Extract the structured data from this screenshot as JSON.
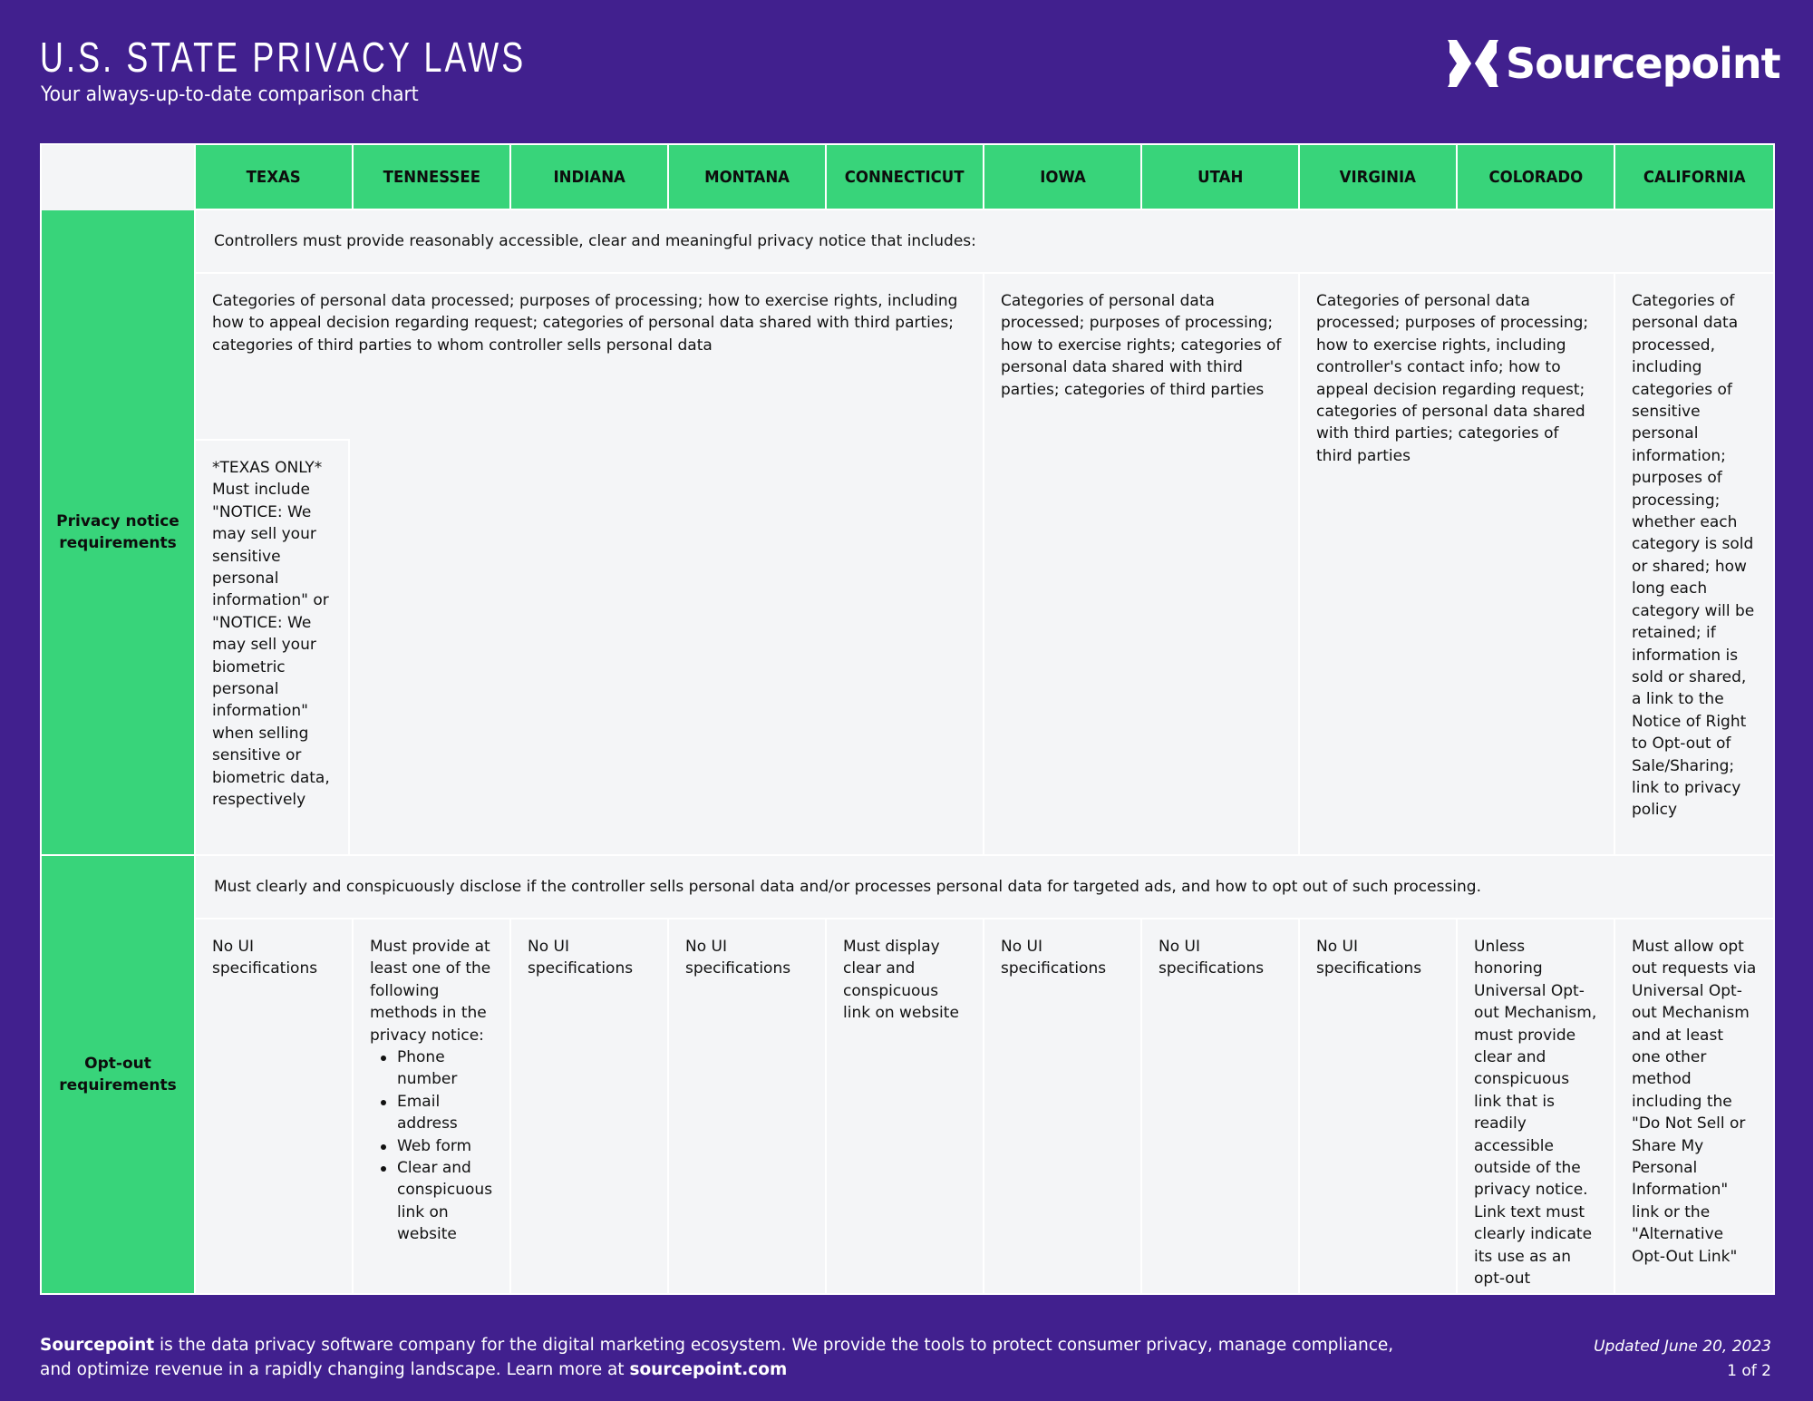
{
  "header": {
    "title": "U.S. STATE PRIVACY LAWS",
    "subtitle": "Your always-up-to-date comparison chart",
    "logo_text": "Sourcepoint",
    "logo_icon": "sourcepoint-chevrons-icon"
  },
  "colors": {
    "background": "#41208e",
    "accent_green": "#38d47a",
    "cell_background": "#f4f5f7"
  },
  "states": [
    "TEXAS",
    "TENNESSEE",
    "INDIANA",
    "MONTANA",
    "CONNECTICUT",
    "IOWA",
    "UTAH",
    "VIRGINIA",
    "COLORADO",
    "CALIFORNIA"
  ],
  "privacy_notice": {
    "label": "Privacy notice requirements",
    "intro": "Controllers must provide reasonably accessible, clear and meaningful privacy notice that includes:",
    "groups": [
      {
        "states": [
          "TEXAS",
          "TENNESSEE",
          "INDIANA",
          "MONTANA",
          "CONNECTICUT"
        ],
        "text": "Categories of personal data processed; purposes of processing; how to exercise rights, including how to appeal decision regarding request; categories of personal data shared with third parties; categories of third parties to whom controller sells personal data"
      },
      {
        "states": [
          "IOWA",
          "UTAH"
        ],
        "text": "Categories of personal data processed; purposes of processing; how to exercise rights; categories of personal data shared with third parties; categories of third parties"
      },
      {
        "states": [
          "VIRGINIA",
          "COLORADO"
        ],
        "text": "Categories of personal data processed; purposes of processing; how to exercise rights, including controller's contact info; how to appeal  decision regarding request; categories of personal data shared with third parties; categories of third parties"
      },
      {
        "states": [
          "CALIFORNIA"
        ],
        "text": "Categories of personal data processed, including categories of sensitive personal information; purposes of processing; whether each category is sold or shared; how long each category will be retained; if information is sold or shared, a link to the Notice of Right to Opt-out of Sale/Sharing; link to privacy policy"
      }
    ],
    "texas_only": "*TEXAS ONLY* Must include \"NOTICE: We may sell your sensitive personal information\" or \"NOTICE: We may sell your biometric personal information\" when selling sensitive or biometric data, respectively"
  },
  "opt_out": {
    "label": "Opt-out requirements",
    "intro": "Must clearly and conspicuously disclose if the controller sells personal data and/or processes personal data for targeted ads, and how to opt out of such processing.",
    "cells": [
      {
        "state": "TEXAS",
        "text": "No UI specifications"
      },
      {
        "state": "TENNESSEE",
        "text": "Must provide at least one of the following methods in the privacy notice:",
        "list": [
          "Phone number",
          "Email address",
          "Web form",
          "Clear and conspicuous link on website"
        ]
      },
      {
        "state": "INDIANA",
        "text": "No UI specifications"
      },
      {
        "state": "MONTANA",
        "text": "No UI specifications"
      },
      {
        "state": "CONNECTICUT",
        "text": "Must display clear and conspicuous link on website"
      },
      {
        "state": "IOWA",
        "text": "No UI specifications"
      },
      {
        "state": "UTAH",
        "text": "No UI specifications"
      },
      {
        "state": "VIRGINIA",
        "text": "No UI specifications"
      },
      {
        "state": "COLORADO",
        "text": "Unless honoring Universal Opt-out Mechanism, must provide clear and conspicuous link that is readily accessible outside of the privacy notice. Link text must clearly indicate its use as an opt-out"
      },
      {
        "state": "CALIFORNIA",
        "text": "Must allow opt out requests via Universal Opt-out Mechanism and at least one other method including the \"Do Not Sell or Share My Personal Information\" link or the \"Alternative Opt-Out Link\""
      }
    ]
  },
  "footer": {
    "company": "Sourcepoint",
    "description_1": " is the data privacy software company for the digital marketing ecosystem. We provide the tools to protect consumer privacy, manage compliance,",
    "description_2": "and optimize revenue in a rapidly changing landscape.  Learn more at ",
    "link": "sourcepoint.com",
    "updated": "Updated June 20, 2023",
    "page": "1 of 2"
  }
}
